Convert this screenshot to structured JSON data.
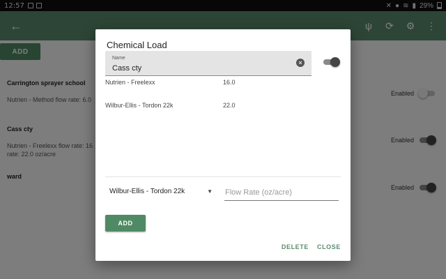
{
  "status_bar": {
    "time": "12:57",
    "battery": "29%"
  },
  "app_bar": {
    "back_icon": "arrow-left-icon",
    "actions": [
      "cactus-icon",
      "sync-icon",
      "tractor-icon",
      "more-vert-icon"
    ]
  },
  "page": {
    "add_label": "ADD",
    "items": [
      {
        "title": "Carrington sprayer school",
        "desc": "Nutrien - Method flow rate: 6.0",
        "status": "Enabled",
        "on": false
      },
      {
        "title": "Cass cty",
        "desc": "Nutrien - Freelexx flow rate: 16",
        "desc2": "rate: 22.0 oz/acre",
        "status": "Enabled",
        "on": true
      },
      {
        "title": "ward",
        "status": "Enabled",
        "on": true
      }
    ]
  },
  "dialog": {
    "title": "Chemical Load",
    "name_field": {
      "label": "Name",
      "value": "Cass cty"
    },
    "enabled": true,
    "chemicals": [
      {
        "name": "Nutrien - Freelexx",
        "rate": "16.0"
      },
      {
        "name": "Wilbur-Ellis - Tordon 22k",
        "rate": "22.0"
      }
    ],
    "selected_chemical": "Wilbur-Ellis - Tordon 22k",
    "flow_rate_placeholder": "Flow Rate (oz/acre)",
    "add_label": "ADD",
    "delete_label": "DELETE",
    "close_label": "CLOSE",
    "accent_color": "#4f8a65"
  }
}
